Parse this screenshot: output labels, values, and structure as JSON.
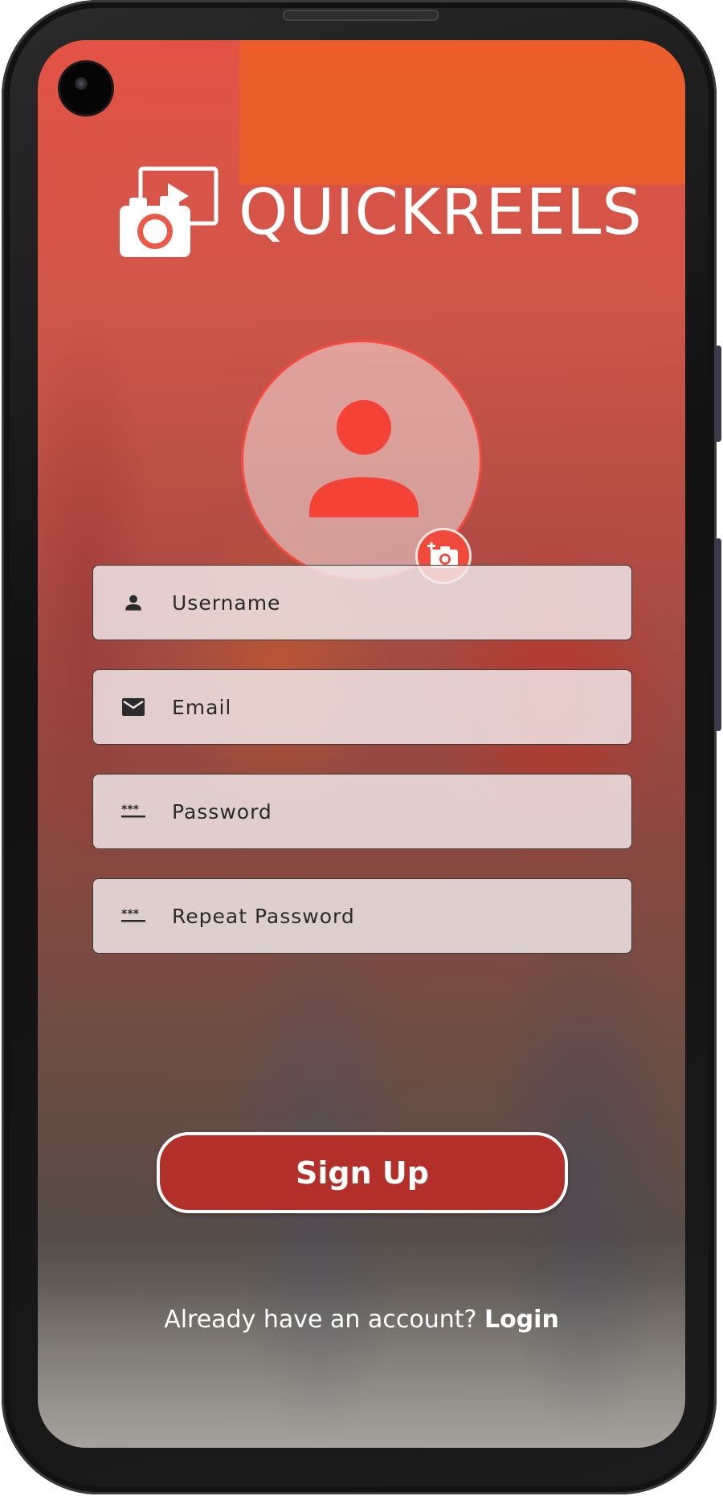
{
  "app": {
    "name": "QUICKREELS",
    "brand_color": "#f44336",
    "button_color": "#b3302a"
  },
  "avatar": {
    "icon": "person-icon",
    "action_icon": "add-photo-icon"
  },
  "form": {
    "username": {
      "placeholder": "Username",
      "icon": "person-icon"
    },
    "email": {
      "placeholder": "Email",
      "icon": "mail-icon"
    },
    "password": {
      "placeholder": "Password",
      "icon": "password-icon"
    },
    "repeat_password": {
      "placeholder": "Repeat Password",
      "icon": "password-icon"
    }
  },
  "actions": {
    "signup_label": "Sign Up",
    "login_prompt": "Already have an account?",
    "login_label": "Login"
  }
}
